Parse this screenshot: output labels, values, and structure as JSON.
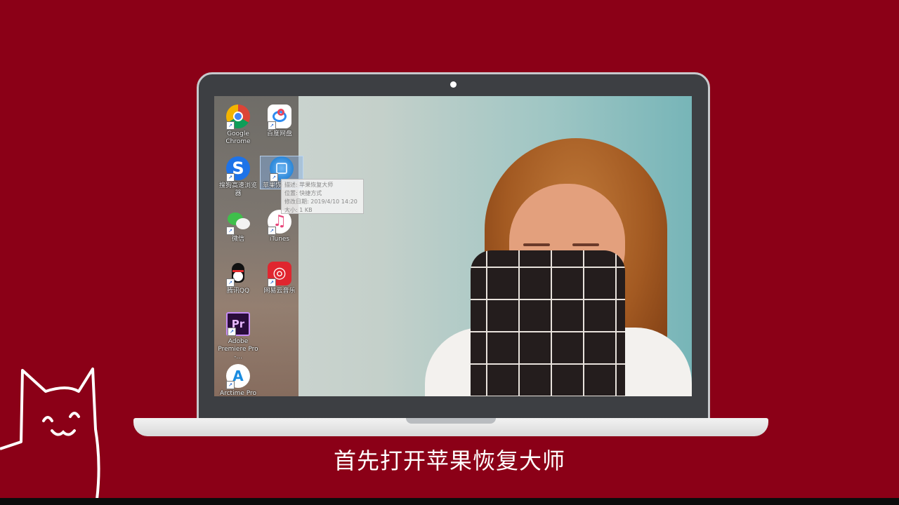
{
  "desktop_icons": [
    {
      "id": "chrome",
      "label": "Google Chrome",
      "icon": "chrome-icon"
    },
    {
      "id": "baidu",
      "label": "百度网盘",
      "icon": "baidu-netdisk-icon"
    },
    {
      "id": "sogou",
      "label": "搜狗高速浏览器",
      "icon": "sogou-browser-icon"
    },
    {
      "id": "apple-recovery",
      "label": "苹果恢复大师",
      "icon": "apple-recovery-icon"
    },
    {
      "id": "wechat",
      "label": "微信",
      "icon": "wechat-icon"
    },
    {
      "id": "itunes",
      "label": "iTunes",
      "icon": "itunes-icon"
    },
    {
      "id": "qq",
      "label": "腾讯QQ",
      "icon": "qq-icon"
    },
    {
      "id": "netease",
      "label": "网易云音乐",
      "icon": "netease-music-icon"
    },
    {
      "id": "premiere",
      "label": "Adobe Premiere Pro -...",
      "icon": "premiere-icon"
    },
    {
      "id": "arctime",
      "label": "Arctime Pro",
      "icon": "arctime-icon"
    }
  ],
  "tooltip": {
    "line1": "描述: 苹果恢复大师",
    "line2": "位置: 快捷方式",
    "line3": "修改日期: 2019/4/10 14:20",
    "line4": "大小: 1 KB"
  },
  "subtitle": "首先打开苹果恢复大师",
  "colors": {
    "background": "#8b0017",
    "laptop_frame": "#3d3f43"
  }
}
